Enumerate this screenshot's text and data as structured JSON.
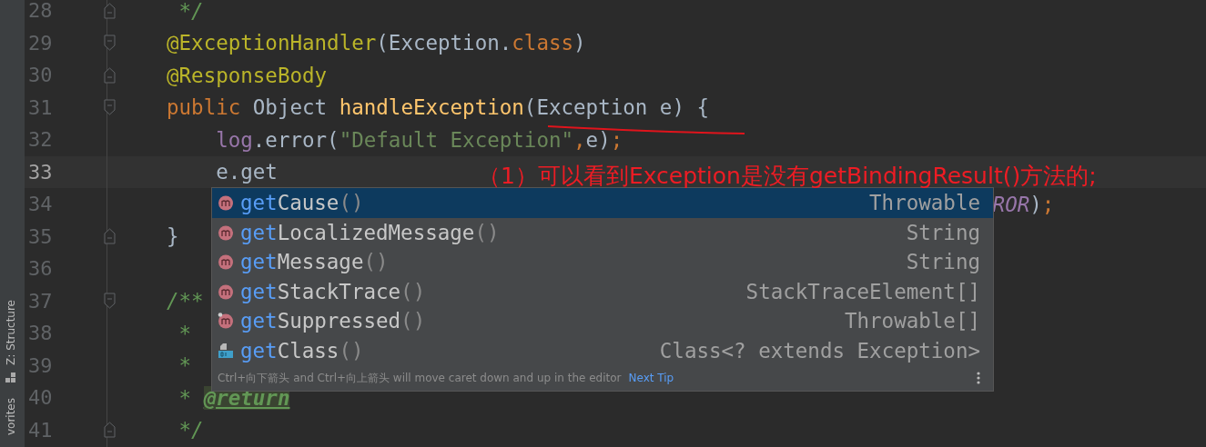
{
  "tool_strip": [
    {
      "label": "Z: Structure"
    },
    {
      "label": "vorites"
    }
  ],
  "lines": [
    {
      "number": "28",
      "current": false,
      "kind": "fold-end",
      "tokens": [
        {
          "text": " */",
          "kind": "doc"
        }
      ]
    },
    {
      "number": "29",
      "current": false,
      "kind": "fold-start",
      "tokens": [
        {
          "text": "@ExceptionHandler",
          "kind": "annotation"
        },
        {
          "text": "(Exception.",
          "kind": "plain"
        },
        {
          "text": "class",
          "kind": "keyword"
        },
        {
          "text": ")",
          "kind": "plain"
        }
      ]
    },
    {
      "number": "30",
      "current": false,
      "kind": "fold-end",
      "tokens": [
        {
          "text": "@ResponseBody",
          "kind": "annotation"
        }
      ]
    },
    {
      "number": "31",
      "current": false,
      "kind": "fold-start",
      "tokens": [
        {
          "text": "public ",
          "kind": "keyword"
        },
        {
          "text": "Object ",
          "kind": "plain"
        },
        {
          "text": "handleException",
          "kind": "method"
        },
        {
          "text": "(Exception e) {",
          "kind": "plain"
        }
      ]
    },
    {
      "number": "32",
      "current": false,
      "kind": "plain",
      "tokens": [
        {
          "text": "    log",
          "kind": "field"
        },
        {
          "text": ".error(",
          "kind": "plain"
        },
        {
          "text": "\"Default Exception\"",
          "kind": "string"
        },
        {
          "text": ",",
          "kind": "keyword"
        },
        {
          "text": "e)",
          "kind": "plain"
        },
        {
          "text": ";",
          "kind": "keyword"
        }
      ]
    },
    {
      "number": "33",
      "current": true,
      "kind": "plain",
      "tokens": [
        {
          "text": "    e.get",
          "kind": "plain"
        }
      ]
    },
    {
      "number": "34",
      "current": false,
      "kind": "plain",
      "tokens": [
        {
          "text": "                                                                   ROR",
          "kind": "constant"
        },
        {
          "text": ")",
          "kind": "plain"
        },
        {
          "text": ";",
          "kind": "keyword"
        }
      ]
    },
    {
      "number": "35",
      "current": false,
      "kind": "fold-end",
      "tokens": [
        {
          "text": "}",
          "kind": "plain"
        }
      ]
    },
    {
      "number": "36",
      "current": false,
      "kind": "plain"
    },
    {
      "number": "37",
      "current": false,
      "kind": "fold-start",
      "tokens": [
        {
          "text": "/**",
          "kind": "doc"
        }
      ]
    },
    {
      "number": "38",
      "current": false,
      "kind": "plain",
      "tokens": [
        {
          "text": " *",
          "kind": "doc"
        }
      ]
    },
    {
      "number": "39",
      "current": false,
      "kind": "plain",
      "tokens": [
        {
          "text": " *",
          "kind": "doc"
        }
      ]
    },
    {
      "number": "40",
      "current": false,
      "kind": "plain",
      "tokens": [
        {
          "text": " * ",
          "kind": "doc"
        },
        {
          "text": "@return",
          "kind": "doctag"
        }
      ]
    },
    {
      "number": "41",
      "current": false,
      "kind": "fold-end",
      "tokens": [
        {
          "text": " */",
          "kind": "doc"
        }
      ]
    }
  ],
  "completion": {
    "items": [
      {
        "kind": "method",
        "typed": "get",
        "rest": "Cause",
        "parens": "()",
        "type": "Throwable",
        "selected": true
      },
      {
        "kind": "method",
        "typed": "get",
        "rest": "LocalizedMessage",
        "parens": "()",
        "type": "String",
        "selected": false
      },
      {
        "kind": "method",
        "typed": "get",
        "rest": "Message",
        "parens": "()",
        "type": "String",
        "selected": false
      },
      {
        "kind": "method",
        "typed": "get",
        "rest": "StackTrace",
        "parens": "()",
        "type": "StackTraceElement[]",
        "selected": false
      },
      {
        "kind": "method-marked",
        "typed": "get",
        "rest": "Suppressed",
        "parens": "()",
        "type": "Throwable[]",
        "selected": false
      },
      {
        "kind": "binary",
        "typed": "get",
        "rest": "Class",
        "parens": "()",
        "type": "Class<? extends Exception>",
        "selected": false
      }
    ],
    "hint": "Ctrl+向下箭头 and Ctrl+向上箭头 will move caret down and up in the editor",
    "hint_link": "Next Tip"
  },
  "annotation": {
    "text": "（1）可以看到Exception是没有getBindingResult()方法的;"
  }
}
